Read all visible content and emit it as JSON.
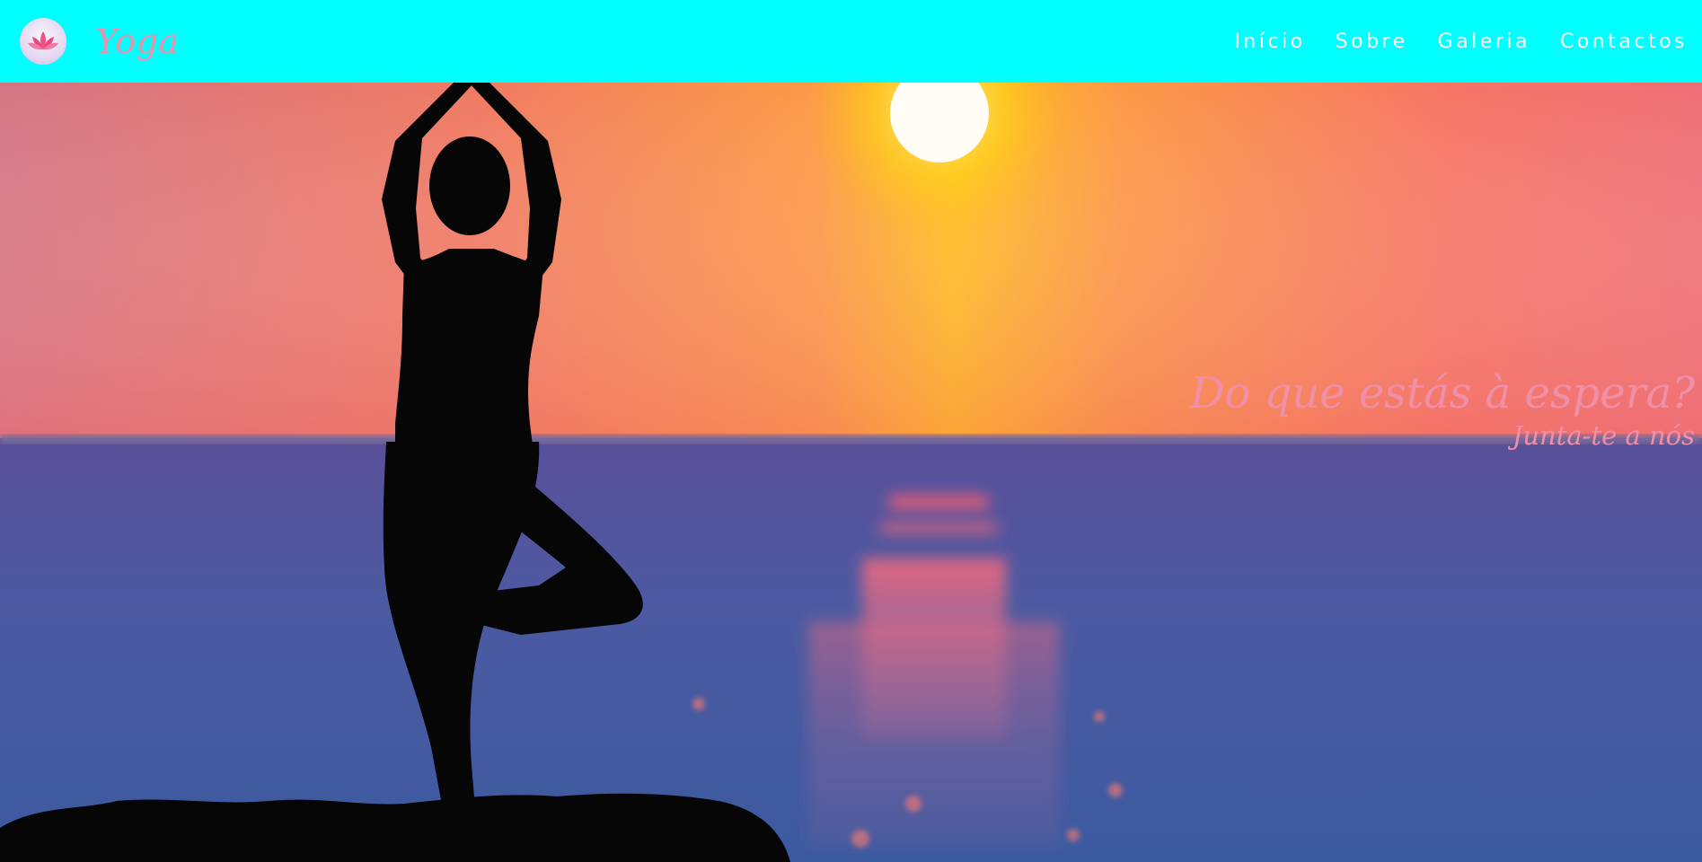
{
  "brand": {
    "name": "Yoga",
    "logo_icon": "lotus-icon"
  },
  "nav": {
    "items": [
      {
        "label": "Início"
      },
      {
        "label": "Sobre"
      },
      {
        "label": "Galeria"
      },
      {
        "label": "Contactos"
      }
    ]
  },
  "hero": {
    "title": "Do que estás à espera?",
    "subtitle": "Junta-te a nós"
  },
  "colors": {
    "navbar_bg": "#00ffff",
    "brand_text": "#f08fa8",
    "nav_text": "#ffffff",
    "cta_text": "#f08fa8"
  }
}
